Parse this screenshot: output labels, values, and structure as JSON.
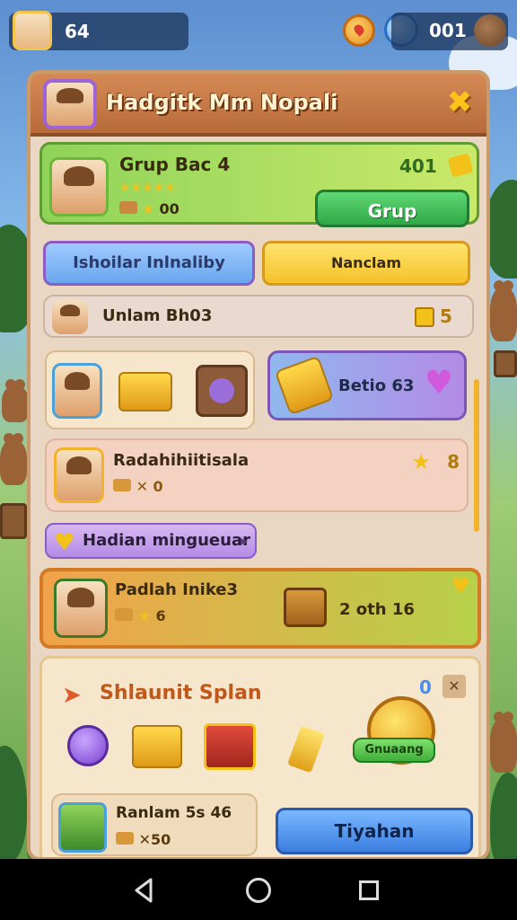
{
  "hud": {
    "level": "64",
    "gems": "001"
  },
  "panel": {
    "title": "Hadgitk Mm Nopali",
    "close": "✖"
  },
  "group_card": {
    "name": "Grup Bac 4",
    "score": "401",
    "stats": "00",
    "button": "Grup"
  },
  "tabs": {
    "left": "Ishoilar Inlnaliby",
    "right": "Nanclam"
  },
  "section_row": {
    "label": "Unlam Bh03",
    "count": "5"
  },
  "reward_box": {
    "label": "Betio 63"
  },
  "friend_row": {
    "name": "Radahihiitisala",
    "count": "8",
    "sub": "✕ 0"
  },
  "tag_pill": {
    "label": "Hadian mingueuar"
  },
  "highlight_card": {
    "name": "Padlah Inike3",
    "sub": "6",
    "value": "2 oth 16"
  },
  "bottom_panel": {
    "title": "Shlaunit Splan",
    "counter": "0",
    "badge": "Gnuaang",
    "player_name": "Ranlam 5s 46",
    "player_sub": "✕50",
    "button": "Tiyahan"
  },
  "colors": {
    "green_btn": "#45c05a",
    "blue_btn": "#4d8ee8",
    "yellow_btn": "#f5c930",
    "purple": "#a66bd6"
  }
}
